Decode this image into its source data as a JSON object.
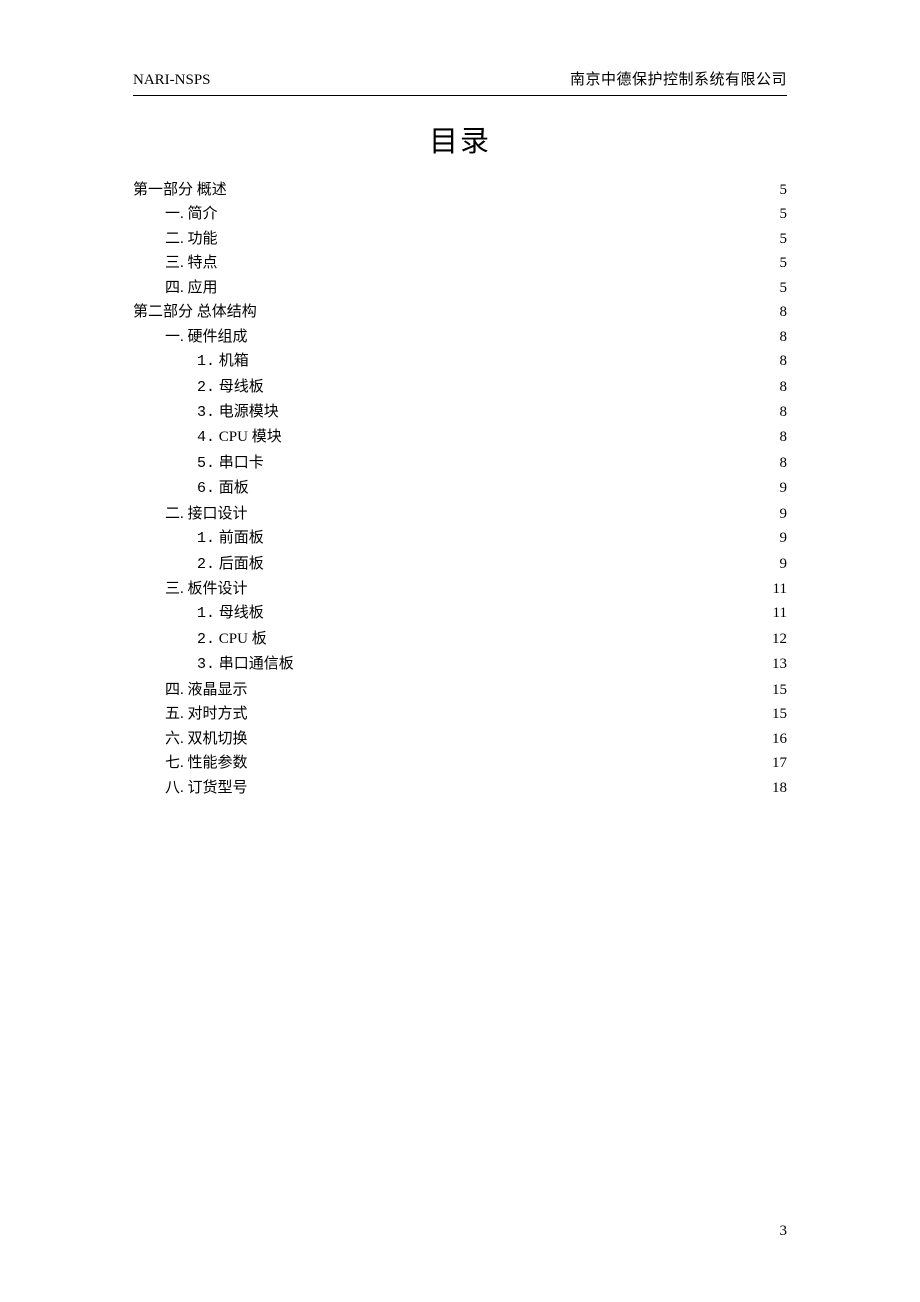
{
  "header": {
    "left": "NARI-NSPS",
    "right": "南京中德保护控制系统有限公司"
  },
  "title": "目录",
  "toc": [
    {
      "indent": 0,
      "num": "",
      "label": "第一部分 概述",
      "page": "5",
      "numClass": ""
    },
    {
      "indent": 1,
      "num": "一.",
      "label": "简介",
      "page": "5",
      "numClass": "cjk-num"
    },
    {
      "indent": 1,
      "num": "二.",
      "label": "功能",
      "page": "5",
      "numClass": "cjk-num"
    },
    {
      "indent": 1,
      "num": "三.",
      "label": "特点",
      "page": "5",
      "numClass": "cjk-num"
    },
    {
      "indent": 1,
      "num": "四.",
      "label": "应用",
      "page": "5",
      "numClass": "cjk-num"
    },
    {
      "indent": 0,
      "num": "",
      "label": "第二部分 总体结构",
      "page": "8",
      "numClass": ""
    },
    {
      "indent": 1,
      "num": "一.",
      "label": "硬件组成",
      "page": "8",
      "numClass": "cjk-num"
    },
    {
      "indent": 2,
      "num": "1.",
      "label": "机箱",
      "page": "8",
      "numClass": "ascii-num"
    },
    {
      "indent": 2,
      "num": "2.",
      "label": "母线板",
      "page": "8",
      "numClass": "ascii-num"
    },
    {
      "indent": 2,
      "num": "3.",
      "label": "电源模块",
      "page": "8",
      "numClass": "ascii-num"
    },
    {
      "indent": 2,
      "num": "4.",
      "label": "CPU 模块",
      "page": "8",
      "numClass": "ascii-num"
    },
    {
      "indent": 2,
      "num": "5.",
      "label": "串口卡",
      "page": "8",
      "numClass": "ascii-num"
    },
    {
      "indent": 2,
      "num": "6.",
      "label": "面板",
      "page": "9",
      "numClass": "ascii-num"
    },
    {
      "indent": 1,
      "num": "二.",
      "label": "接口设计",
      "page": "9",
      "numClass": "cjk-num"
    },
    {
      "indent": 2,
      "num": "1.",
      "label": "前面板",
      "page": "9",
      "numClass": "ascii-num"
    },
    {
      "indent": 2,
      "num": "2.",
      "label": "后面板",
      "page": "9",
      "numClass": "ascii-num"
    },
    {
      "indent": 1,
      "num": "三.",
      "label": "板件设计",
      "page": "11",
      "numClass": "cjk-num"
    },
    {
      "indent": 2,
      "num": "1.",
      "label": "母线板",
      "page": "11",
      "numClass": "ascii-num"
    },
    {
      "indent": 2,
      "num": "2.",
      "label": "CPU 板",
      "page": "12",
      "numClass": "ascii-num"
    },
    {
      "indent": 2,
      "num": "3.",
      "label": "串口通信板",
      "page": "13",
      "numClass": "ascii-num"
    },
    {
      "indent": 1,
      "num": "四.",
      "label": "液晶显示",
      "page": "15",
      "numClass": "cjk-num"
    },
    {
      "indent": 1,
      "num": "五.",
      "label": "对时方式",
      "page": "15",
      "numClass": "cjk-num"
    },
    {
      "indent": 1,
      "num": "六.",
      "label": "双机切换",
      "page": "16",
      "numClass": "cjk-num"
    },
    {
      "indent": 1,
      "num": "七.",
      "label": "性能参数",
      "page": "17",
      "numClass": "cjk-num"
    },
    {
      "indent": 1,
      "num": "八.",
      "label": "订货型号",
      "page": "18",
      "numClass": "cjk-num"
    }
  ],
  "pageNumber": "3"
}
